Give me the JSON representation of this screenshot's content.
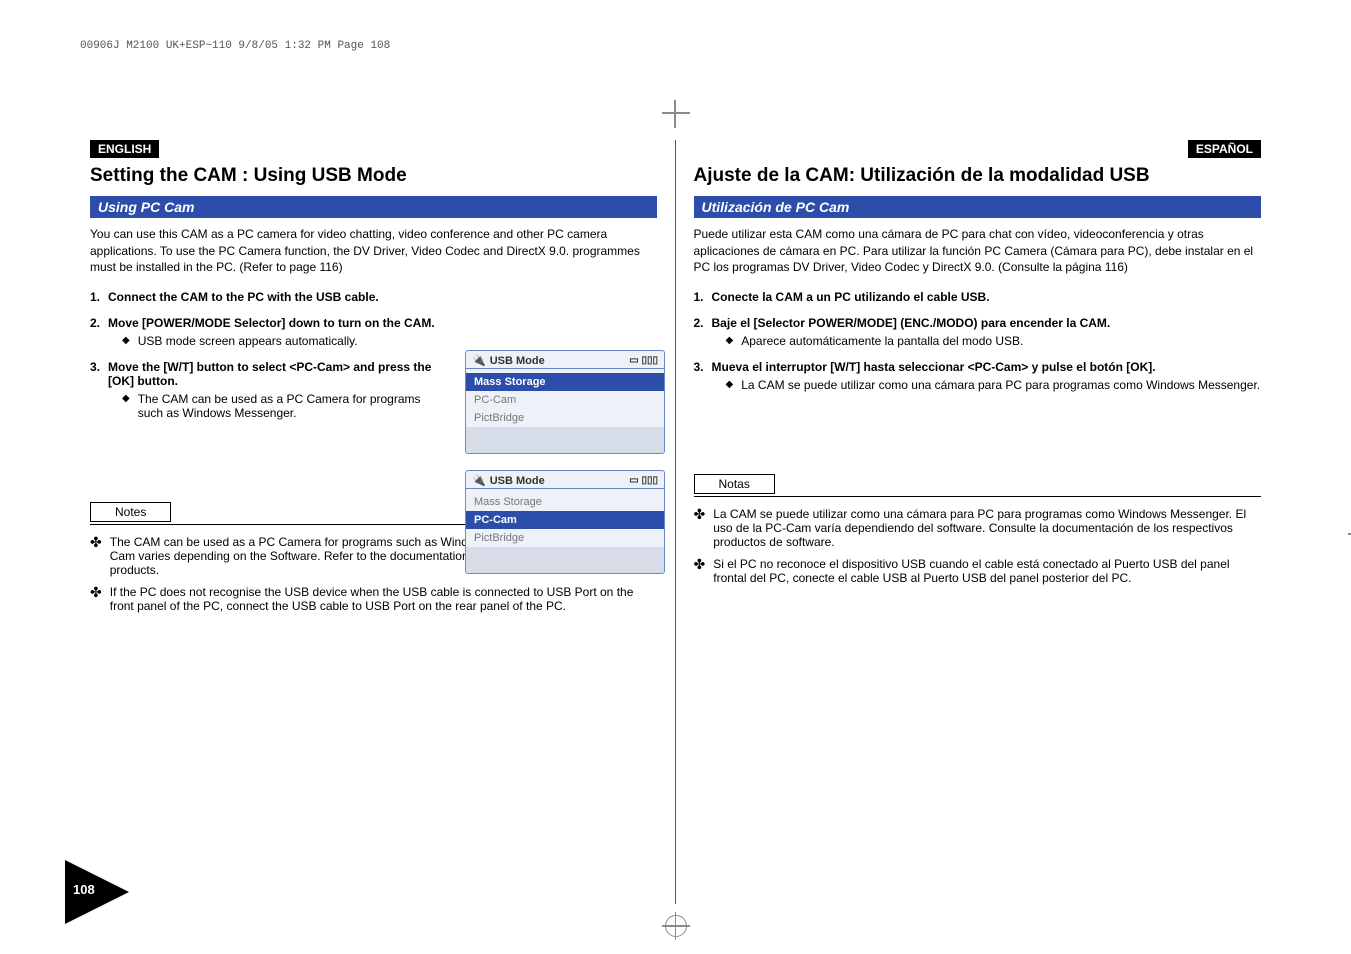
{
  "header_line": "00906J M2100 UK+ESP~110   9/8/05  1:32 PM   Page 108",
  "page_number": "108",
  "left": {
    "lang": "ENGLISH",
    "title": "Setting the CAM : Using USB Mode",
    "section": "Using PC Cam",
    "intro": "You can use this CAM as a PC camera for video chatting, video conference and other PC camera applications. To use the PC Camera function, the DV Driver, Video Codec and DirectX 9.0. programmes must be installed in the PC. (Refer to page 116)",
    "steps": [
      {
        "n": "1.",
        "strong": "Connect the CAM to the PC with the USB cable.",
        "rest": "",
        "bullets": []
      },
      {
        "n": "2.",
        "strong": "Move [POWER/MODE Selector] down to turn on the CAM.",
        "rest": "",
        "bullets": [
          "USB mode screen appears automatically."
        ]
      },
      {
        "n": "3.",
        "strong": "Move the [W/T] button to select <PC-Cam> and press the [OK] button.",
        "rest": "",
        "bullets": [
          "The CAM can be used as a PC Camera for programs such as Windows Messenger."
        ]
      }
    ],
    "notes_label": "Notes",
    "notes": [
      "The CAM can be used as a PC Camera for programs such as Windows Messenger. The use of the PC Cam varies depending on the Software. Refer to the documentation of the respective software products.",
      "If the PC does not recognise the USB device when the USB cable is connected to USB Port on the front panel of the PC, connect the USB cable to USB Port on the rear panel of the PC."
    ]
  },
  "right": {
    "lang": "ESPAÑOL",
    "title": "Ajuste de la CAM: Utilización de la modalidad USB",
    "section": "Utilización de PC Cam",
    "intro": "Puede utilizar esta CAM como una cámara de PC para chat con vídeo, videoconferencia y otras aplicaciones de cámara en PC. Para utilizar la función PC Camera (Cámara para PC), debe instalar en el PC los programas DV Driver, Video Codec y DirectX 9.0. (Consulte la página 116)",
    "steps": [
      {
        "n": "1.",
        "strong": "Conecte la CAM a un PC utilizando el cable USB.",
        "rest": "",
        "bullets": []
      },
      {
        "n": "2.",
        "strong": "Baje el [Selector POWER/MODE] (ENC./MODO) para encender la CAM.",
        "rest": "",
        "bullets": [
          "Aparece automáticamente la pantalla del modo USB."
        ]
      },
      {
        "n": "3.",
        "strong": "Mueva el interruptor [W/T] hasta seleccionar <PC-Cam> y pulse el botón [OK].",
        "rest": "",
        "bullets": [
          "La CAM se puede utilizar como una cámara para PC para programas como Windows Messenger."
        ]
      }
    ],
    "notes_label": "Notas",
    "notes": [
      "La CAM se puede utilizar como una cámara para PC para programas como Windows Messenger. El uso de la PC-Cam varía dependiendo del software. Consulte la documentación de los respectivos productos de software.",
      "Si el PC no reconoce el dispositivo USB cuando el cable está conectado al Puerto USB del panel frontal del PC, conecte el cable USB al Puerto USB del panel posterior del PC."
    ]
  },
  "shots": [
    {
      "num": "2",
      "title": "USB Mode",
      "rows": [
        "Mass Storage",
        "PC-Cam",
        "PictBridge"
      ],
      "selected": 0
    },
    {
      "num": "3",
      "title": "USB Mode",
      "rows": [
        "Mass Storage",
        "PC-Cam",
        "PictBridge"
      ],
      "selected": 1
    }
  ]
}
